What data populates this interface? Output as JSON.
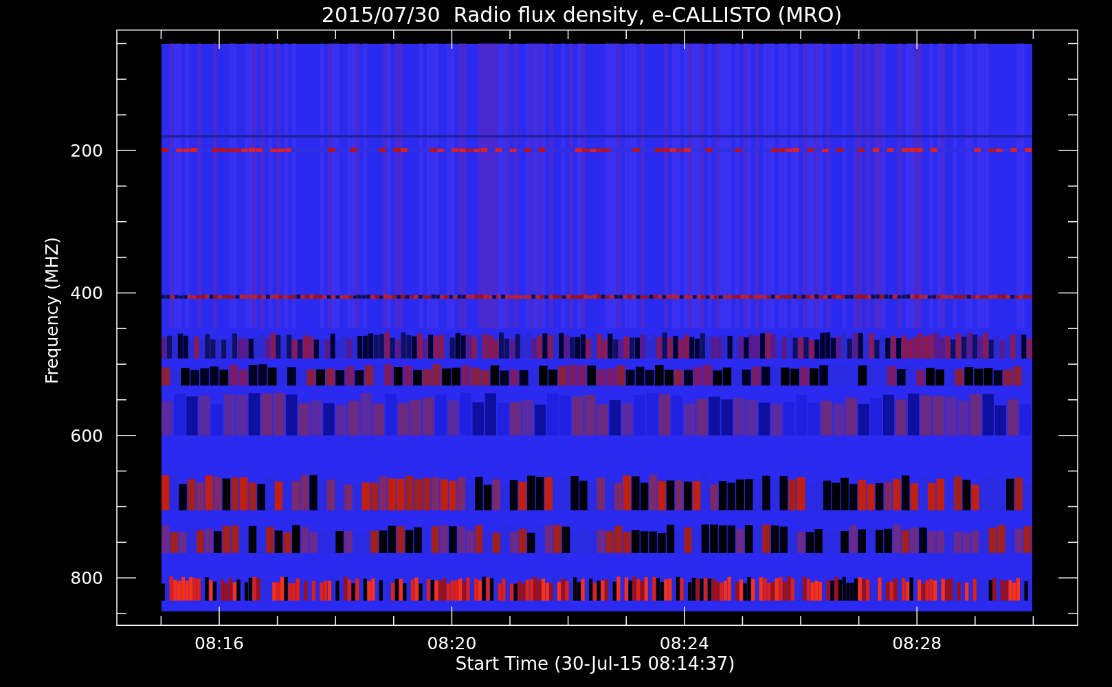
{
  "title": "2015/07/30  Radio flux density, e-CALLISTO (MRO)",
  "y_axis": {
    "label": "Frequency (MHZ)",
    "ticks": [
      "200",
      "400",
      "600",
      "800"
    ]
  },
  "x_axis": {
    "label": "Start Time (30-Jul-15 08:14:37)",
    "ticks": [
      "08:16",
      "08:20",
      "08:24",
      "08:28"
    ]
  }
}
